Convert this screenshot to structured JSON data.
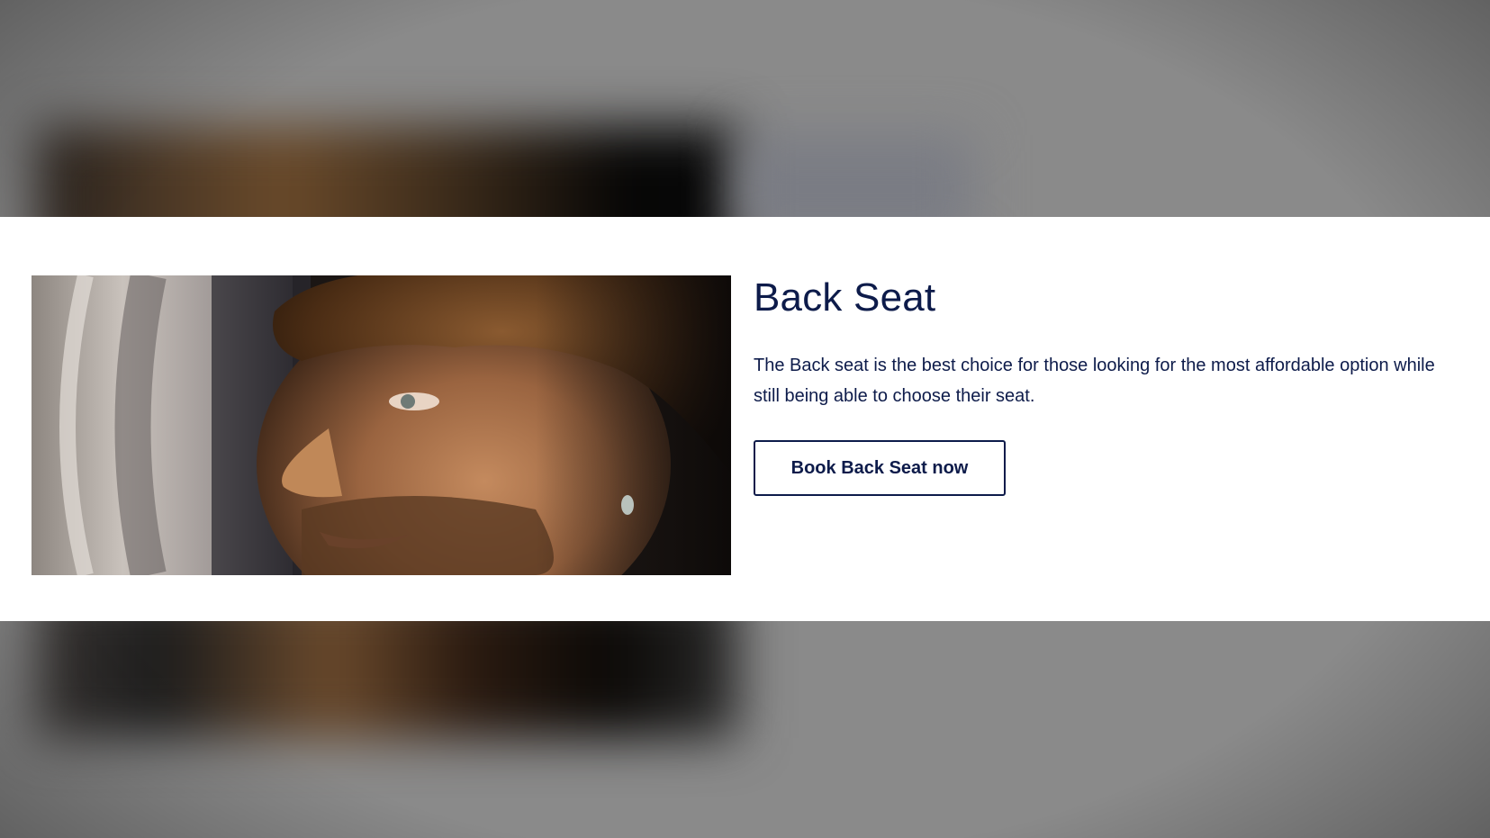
{
  "card": {
    "title": "Back Seat",
    "description": "The Back seat is the best choice for those looking for the most affordable option while still being able to choose their seat.",
    "cta_label": "Book Back Seat now"
  },
  "colors": {
    "text": "#0d1b4a",
    "backdrop": "#888888",
    "card_background": "#ffffff"
  }
}
